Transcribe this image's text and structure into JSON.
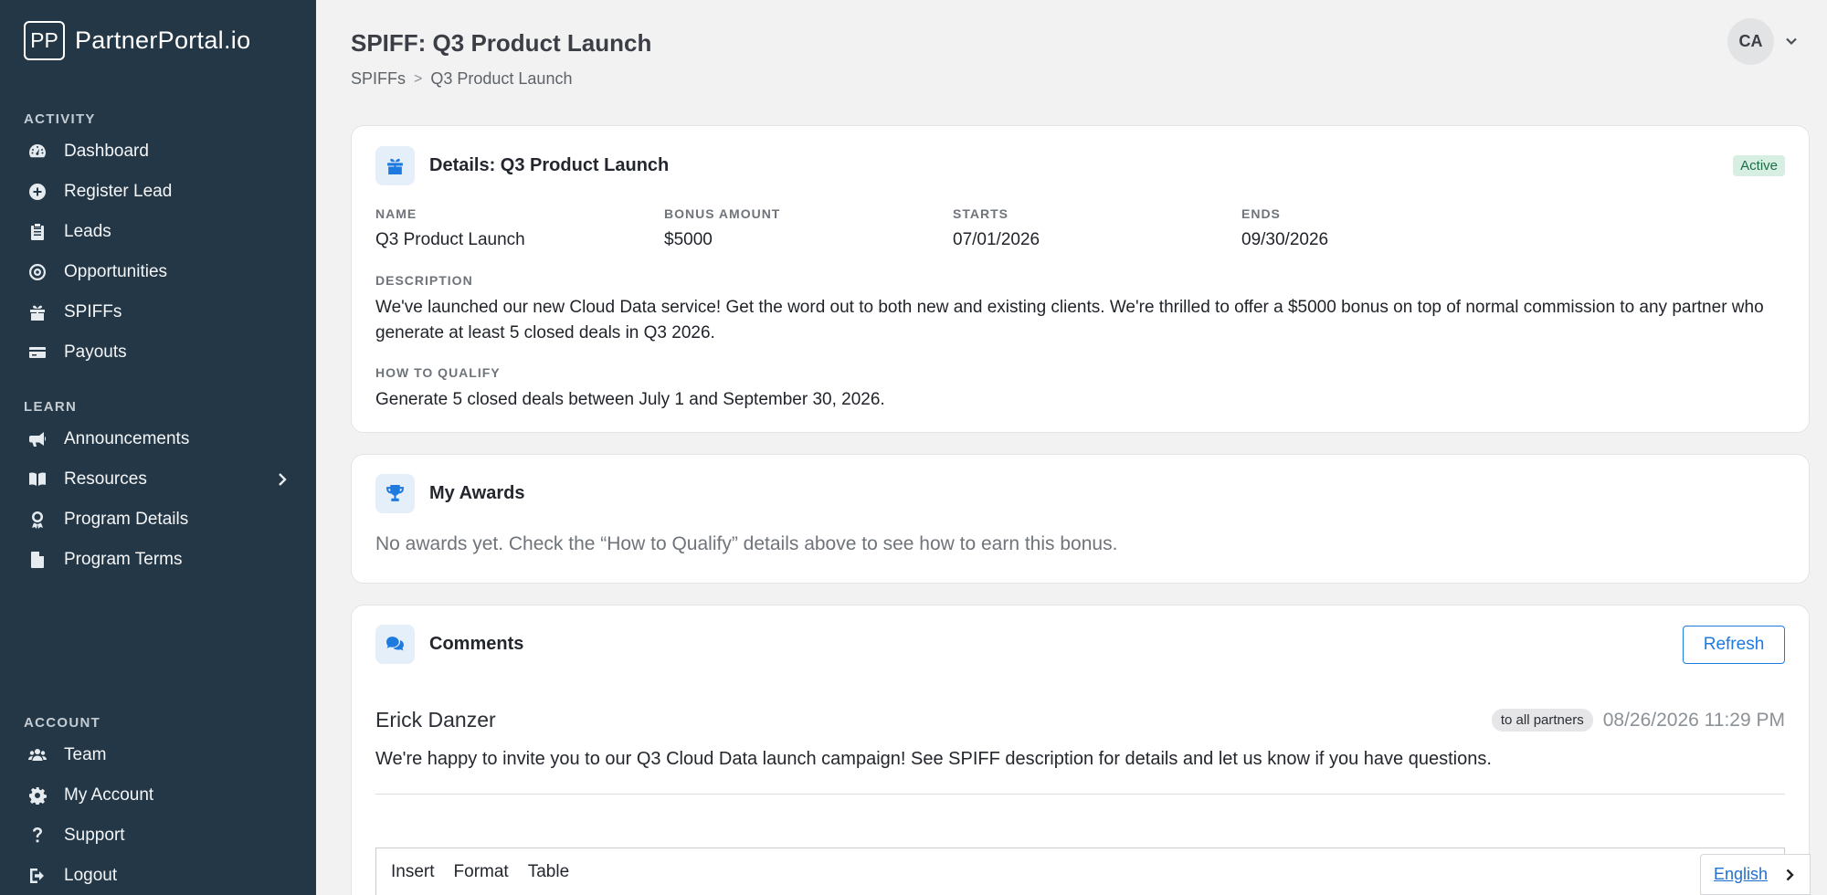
{
  "brand": {
    "mark": "PP",
    "name": "PartnerPortal.io"
  },
  "sidebar": {
    "sections": [
      {
        "label": "ACTIVITY",
        "items": [
          {
            "label": "Dashboard",
            "icon": "dashboard-icon"
          },
          {
            "label": "Register Lead",
            "icon": "plus-circle-icon"
          },
          {
            "label": "Leads",
            "icon": "clipboard-icon"
          },
          {
            "label": "Opportunities",
            "icon": "target-icon"
          },
          {
            "label": "SPIFFs",
            "icon": "gift-icon"
          },
          {
            "label": "Payouts",
            "icon": "credit-card-icon"
          }
        ]
      },
      {
        "label": "LEARN",
        "items": [
          {
            "label": "Announcements",
            "icon": "megaphone-icon"
          },
          {
            "label": "Resources",
            "icon": "book-icon"
          },
          {
            "label": "Program Details",
            "icon": "award-icon"
          },
          {
            "label": "Program Terms",
            "icon": "file-icon"
          }
        ]
      },
      {
        "label": "ACCOUNT",
        "items": [
          {
            "label": "Team",
            "icon": "users-icon"
          },
          {
            "label": "My Account",
            "icon": "gear-icon"
          },
          {
            "label": "Support",
            "icon": "question-icon"
          },
          {
            "label": "Logout",
            "icon": "logout-icon"
          }
        ]
      }
    ]
  },
  "header": {
    "title": "SPIFF: Q3 Product Launch",
    "breadcrumb": {
      "parent": "SPIFFs",
      "separator": ">",
      "current": "Q3 Product Launch"
    },
    "user_initials": "CA"
  },
  "details": {
    "title": "Details: Q3 Product Launch",
    "status": "Active",
    "fields": {
      "name": {
        "label": "NAME",
        "value": "Q3 Product Launch"
      },
      "bonus": {
        "label": "BONUS AMOUNT",
        "value": "$5000"
      },
      "starts": {
        "label": "STARTS",
        "value": "07/01/2026"
      },
      "ends": {
        "label": "ENDS",
        "value": "09/30/2026"
      }
    },
    "description": {
      "label": "DESCRIPTION",
      "value": "We've launched our new Cloud Data service! Get the word out to both new and existing clients. We're thrilled to offer a $5000 bonus on top of normal commission to any partner who generate at least 5 closed deals in Q3 2026."
    },
    "qualify": {
      "label": "HOW TO QUALIFY",
      "value": "Generate 5 closed deals between July 1 and September 30, 2026."
    }
  },
  "awards": {
    "title": "My Awards",
    "empty_text": "No awards yet. Check the “How to Qualify” details above to see how to earn this bonus."
  },
  "comments": {
    "title": "Comments",
    "refresh_label": "Refresh",
    "items": [
      {
        "author": "Erick Danzer",
        "audience": "to all partners",
        "timestamp": "08/26/2026 11:29 PM",
        "body": "We're happy to invite you to our Q3 Cloud Data launch campaign! See SPIFF description for details and let us know if you have questions."
      }
    ],
    "editor_menu": [
      "Insert",
      "Format",
      "Table"
    ]
  },
  "language": {
    "current": "English"
  },
  "colors": {
    "sidebar_bg": "#243746",
    "accent": "#1f7ae0",
    "active_badge_bg": "#d7efe3"
  }
}
